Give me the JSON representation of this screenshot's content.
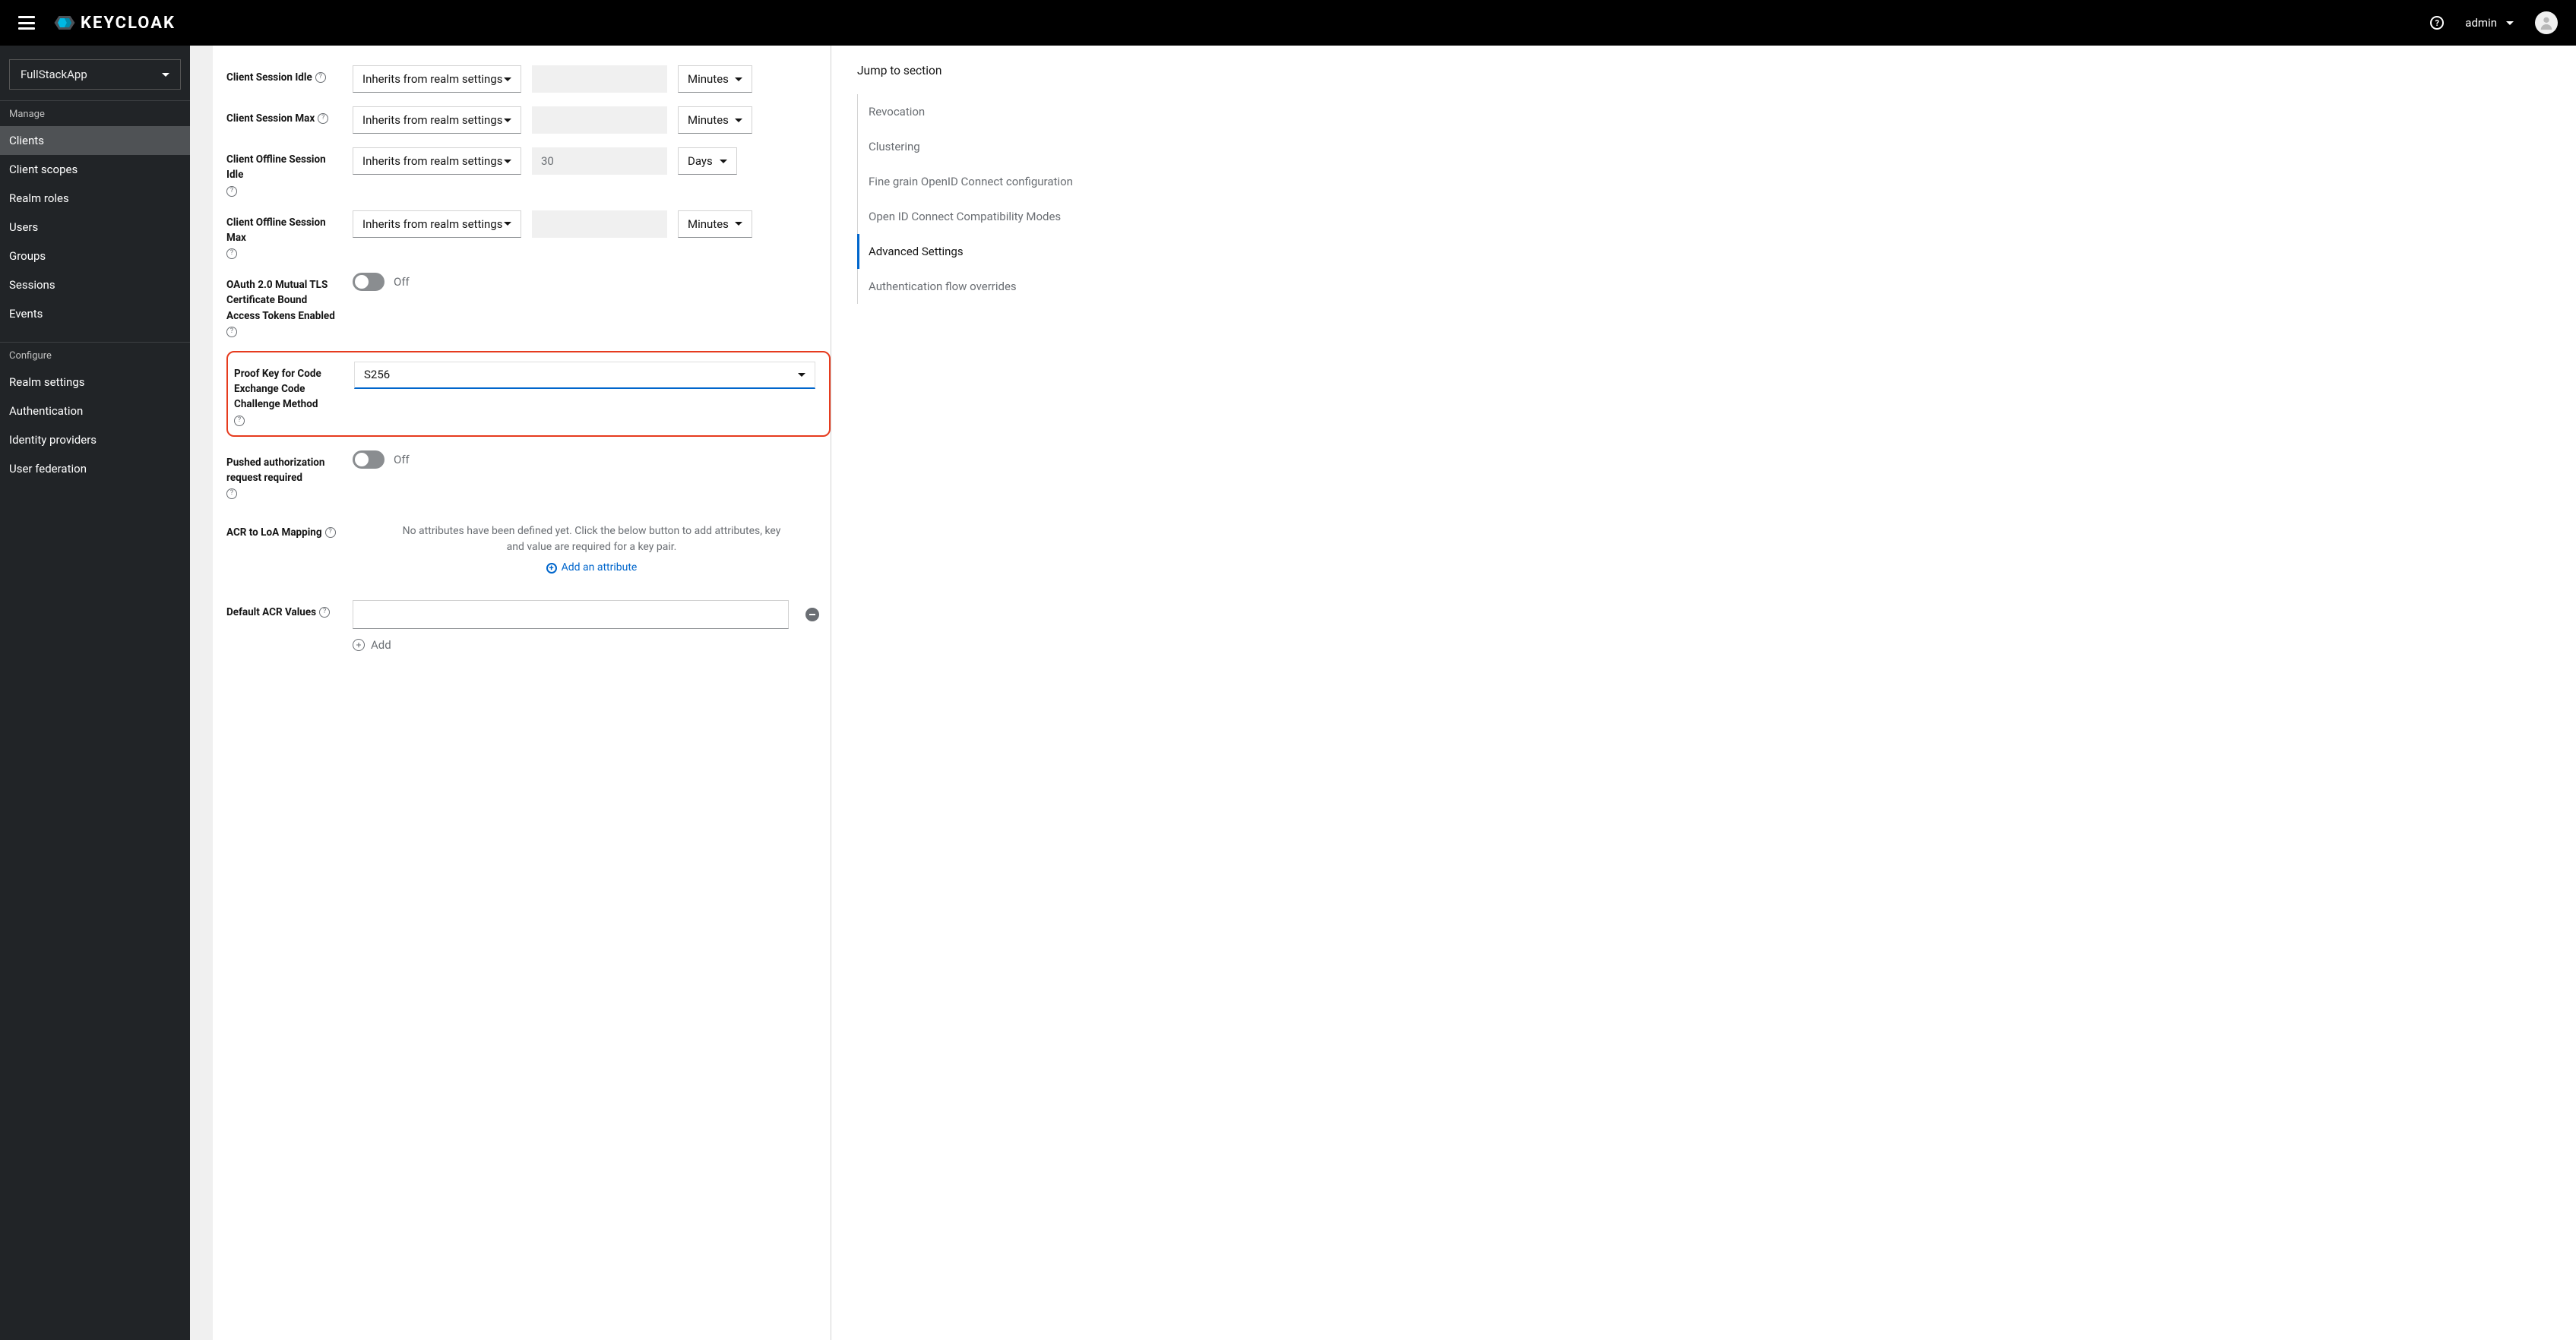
{
  "header": {
    "brand": "KEYCLOAK",
    "user": "admin"
  },
  "sidebar": {
    "realm": "FullStackApp",
    "manage_label": "Manage",
    "configure_label": "Configure",
    "manage_items": [
      "Clients",
      "Client scopes",
      "Realm roles",
      "Users",
      "Groups",
      "Sessions",
      "Events"
    ],
    "configure_items": [
      "Realm settings",
      "Authentication",
      "Identity providers",
      "User federation"
    ]
  },
  "form": {
    "rows": {
      "client_session_idle": {
        "label": "Client Session Idle",
        "select": "Inherits from realm settings",
        "value": "",
        "unit": "Minutes"
      },
      "client_session_max": {
        "label": "Client Session Max",
        "select": "Inherits from realm settings",
        "value": "",
        "unit": "Minutes"
      },
      "client_offline_idle": {
        "label": "Client Offline Session Idle",
        "select": "Inherits from realm settings",
        "value": "30",
        "unit": "Days"
      },
      "client_offline_max": {
        "label": "Client Offline Session Max",
        "select": "Inherits from realm settings",
        "value": "",
        "unit": "Minutes"
      },
      "oauth_mtls": {
        "label": "OAuth 2.0 Mutual TLS Certificate Bound Access Tokens Enabled",
        "state": "Off"
      },
      "pkce": {
        "label": "Proof Key for Code Exchange Code Challenge Method",
        "value": "S256"
      },
      "pushed_auth": {
        "label": "Pushed authorization request required",
        "state": "Off"
      },
      "acr_loa": {
        "label": "ACR to LoA Mapping",
        "empty_text": "No attributes have been defined yet. Click the below button to add attributes, key and value are required for a key pair.",
        "add_label": "Add an attribute"
      },
      "default_acr": {
        "label": "Default ACR Values",
        "value": "",
        "add_label": "Add"
      }
    }
  },
  "jump": {
    "title": "Jump to section",
    "items": [
      "Revocation",
      "Clustering",
      "Fine grain OpenID Connect configuration",
      "Open ID Connect Compatibility Modes",
      "Advanced Settings",
      "Authentication flow overrides"
    ],
    "active": "Advanced Settings"
  }
}
